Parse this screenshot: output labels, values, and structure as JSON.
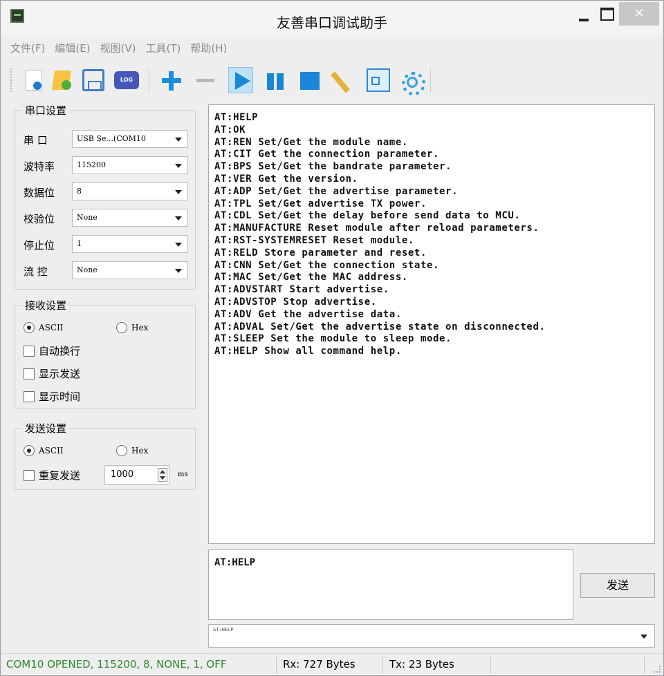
{
  "window": {
    "title": "友善串口调试助手",
    "close_glyph": "✕"
  },
  "menu": [
    "文件(F)",
    "编辑(E)",
    "视图(V)",
    "工具(T)",
    "帮助(H)"
  ],
  "toolbar": {
    "icons": [
      "new-file-icon",
      "open-file-icon",
      "save-icon",
      "log-icon",
      "add-icon",
      "remove-icon",
      "play-icon",
      "pause-icon",
      "stop-icon",
      "clear-broom-icon",
      "window-icon",
      "settings-gear-icon"
    ],
    "log_label": "LOG"
  },
  "serial_settings": {
    "title": "串口设置",
    "rows": [
      {
        "label": "串 口",
        "value": "USB Se...(COM10"
      },
      {
        "label": "波特率",
        "value": "115200"
      },
      {
        "label": "数据位",
        "value": "8"
      },
      {
        "label": "校验位",
        "value": "None"
      },
      {
        "label": "停止位",
        "value": "1"
      },
      {
        "label": "流 控",
        "value": "None"
      }
    ]
  },
  "receive_settings": {
    "title": "接收设置",
    "radio_ascii": "ASCII",
    "radio_hex": "Hex",
    "selected": "ASCII",
    "auto_wrap": "自动换行",
    "show_send": "显示发送",
    "show_time": "显示时间"
  },
  "send_settings": {
    "title": "发送设置",
    "radio_ascii": "ASCII",
    "radio_hex": "Hex",
    "selected": "ASCII",
    "repeat_send": "重复发送",
    "interval": "1000",
    "unit": "ms"
  },
  "receive_lines": [
    "AT:HELP",
    "AT:OK",
    "AT:REN Set/Get the module name.",
    "AT:CIT Get the connection parameter.",
    "AT:BPS Set/Get the bandrate parameter.",
    "AT:VER Get the version.",
    "AT:ADP Set/Get the advertise parameter.",
    "AT:TPL Set/Get advertise TX power.",
    "AT:CDL Set/Get the delay before send data to MCU.",
    "AT:MANUFACTURE Reset module after reload parameters.",
    "AT:RST-SYSTEMRESET Reset module.",
    "AT:RELD Store parameter and reset.",
    "AT:CNN Set/Get the connection state.",
    "AT:MAC Set/Get the MAC address.",
    "AT:ADVSTART Start advertise.",
    "AT:ADVSTOP Stop advertise.",
    "AT:ADV Get the advertise data.",
    "AT:ADVAL Set/Get the advertise state on disconnected.",
    "AT:SLEEP Set the module to sleep mode.",
    "AT:HELP Show all command help."
  ],
  "send": {
    "text": "AT:HELP",
    "button": "发送",
    "history_value": "AT:HELP"
  },
  "status": {
    "port_state": "COM10 OPENED, 115200, 8, NONE, 1, OFF",
    "rx": "Rx: 727 Bytes",
    "tx": "Tx: 23 Bytes",
    "port_state_color": "#2a8a2a"
  }
}
